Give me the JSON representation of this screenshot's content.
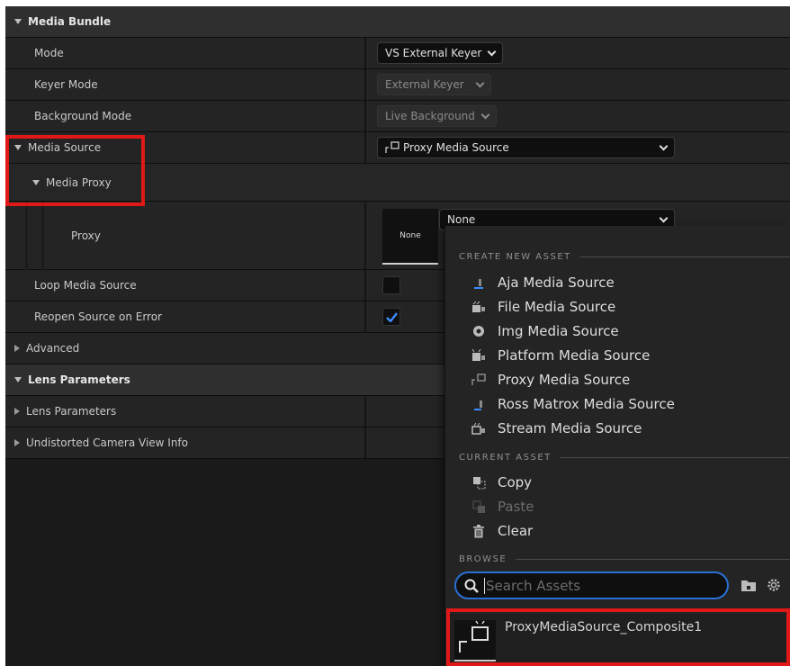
{
  "media_bundle": {
    "title": "Media Bundle",
    "mode_label": "Mode",
    "mode_value": "VS External Keyer",
    "keyer_mode_label": "Keyer Mode",
    "keyer_mode_value": "External Keyer",
    "background_mode_label": "Background Mode",
    "background_mode_value": "Live Background",
    "media_source_label": "Media Source",
    "media_source_value": "Proxy Media Source",
    "media_proxy_label": "Media Proxy",
    "proxy_label": "Proxy",
    "proxy_thumb_text": "None",
    "proxy_value": "None",
    "loop_label": "Loop Media Source",
    "loop_checked": false,
    "reopen_label": "Reopen Source on Error",
    "reopen_checked": true,
    "advanced_label": "Advanced"
  },
  "lens": {
    "title": "Lens Parameters",
    "params_label": "Lens Parameters",
    "undistorted_label": "Undistorted Camera View Info"
  },
  "menu": {
    "create_header": "CREATE NEW ASSET",
    "create_items": [
      {
        "label": "Aja Media Source",
        "icon": "aja-source-icon"
      },
      {
        "label": "File Media Source",
        "icon": "file-source-icon"
      },
      {
        "label": "Img Media Source",
        "icon": "img-source-icon"
      },
      {
        "label": "Platform Media Source",
        "icon": "platform-source-icon"
      },
      {
        "label": "Proxy Media Source",
        "icon": "proxy-source-icon"
      },
      {
        "label": "Ross Matrox Media Source",
        "icon": "ross-source-icon"
      },
      {
        "label": "Stream Media Source",
        "icon": "stream-source-icon"
      }
    ],
    "current_header": "CURRENT ASSET",
    "copy_label": "Copy",
    "paste_label": "Paste",
    "clear_label": "Clear",
    "browse_header": "BROWSE",
    "search_placeholder": "Search Assets",
    "result_name": "ProxyMediaSource_Composite1"
  },
  "colors": {
    "highlight": "#e01818",
    "focus": "#2a6fd6",
    "check": "#3d8cff"
  }
}
